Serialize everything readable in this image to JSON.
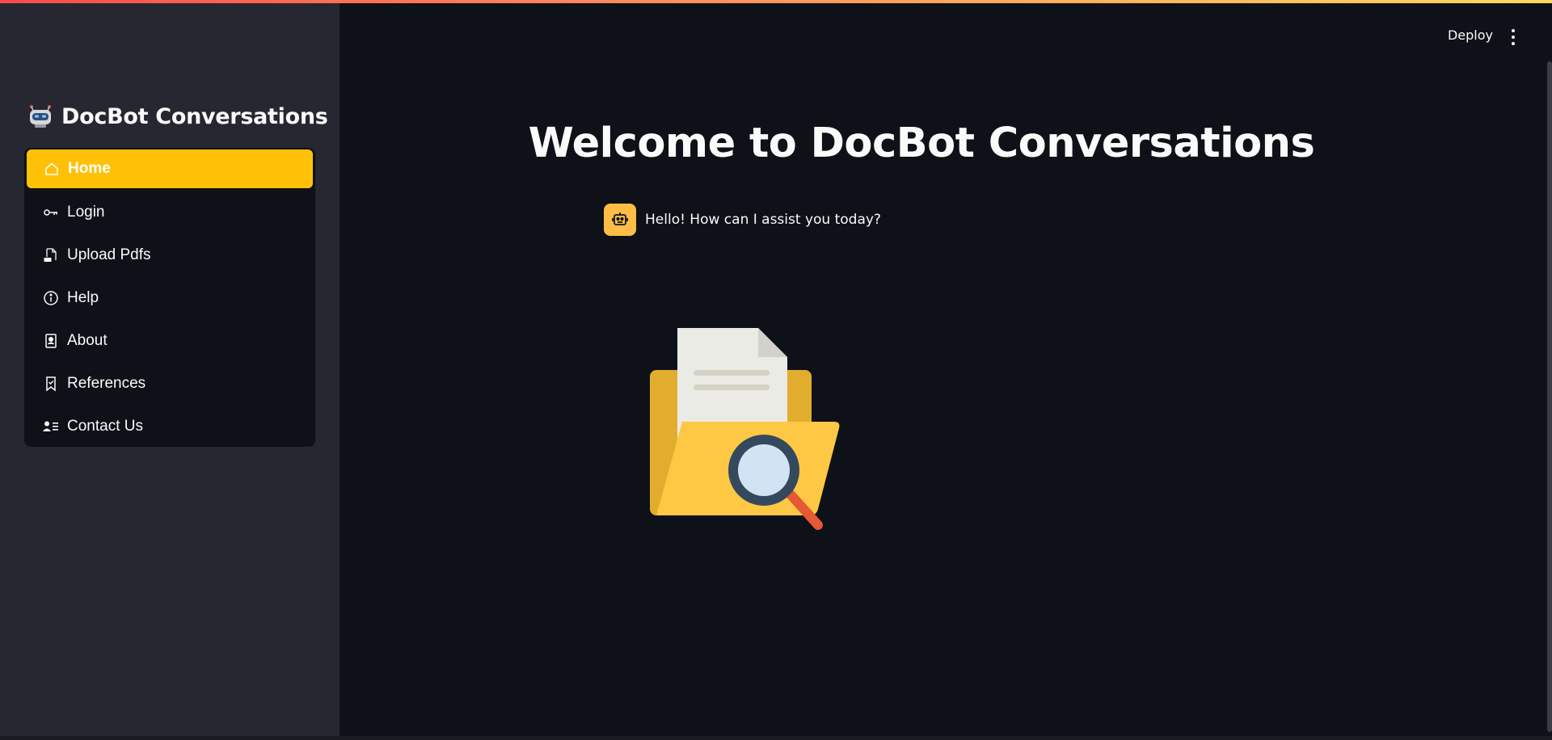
{
  "app": {
    "title": "DocBot Conversations"
  },
  "header": {
    "deploy_label": "Deploy"
  },
  "sidebar": {
    "items": [
      {
        "label": "Home",
        "icon": "house-icon",
        "active": true
      },
      {
        "label": "Login",
        "icon": "key-icon",
        "active": false
      },
      {
        "label": "Upload Pdfs",
        "icon": "pdf-file-icon",
        "active": false
      },
      {
        "label": "Help",
        "icon": "info-circle-icon",
        "active": false
      },
      {
        "label": "About",
        "icon": "person-card-icon",
        "active": false
      },
      {
        "label": "References",
        "icon": "bookmark-icon",
        "active": false
      },
      {
        "label": "Contact Us",
        "icon": "contact-list-icon",
        "active": false
      }
    ]
  },
  "main": {
    "heading": "Welcome to DocBot Conversations",
    "chat": {
      "message": "Hello! How can I assist you today?"
    }
  },
  "colors": {
    "accent": "#ffc107",
    "sidebar_bg": "#262730",
    "main_bg": "#0e1117",
    "avatar_bg": "#ffbd45"
  }
}
